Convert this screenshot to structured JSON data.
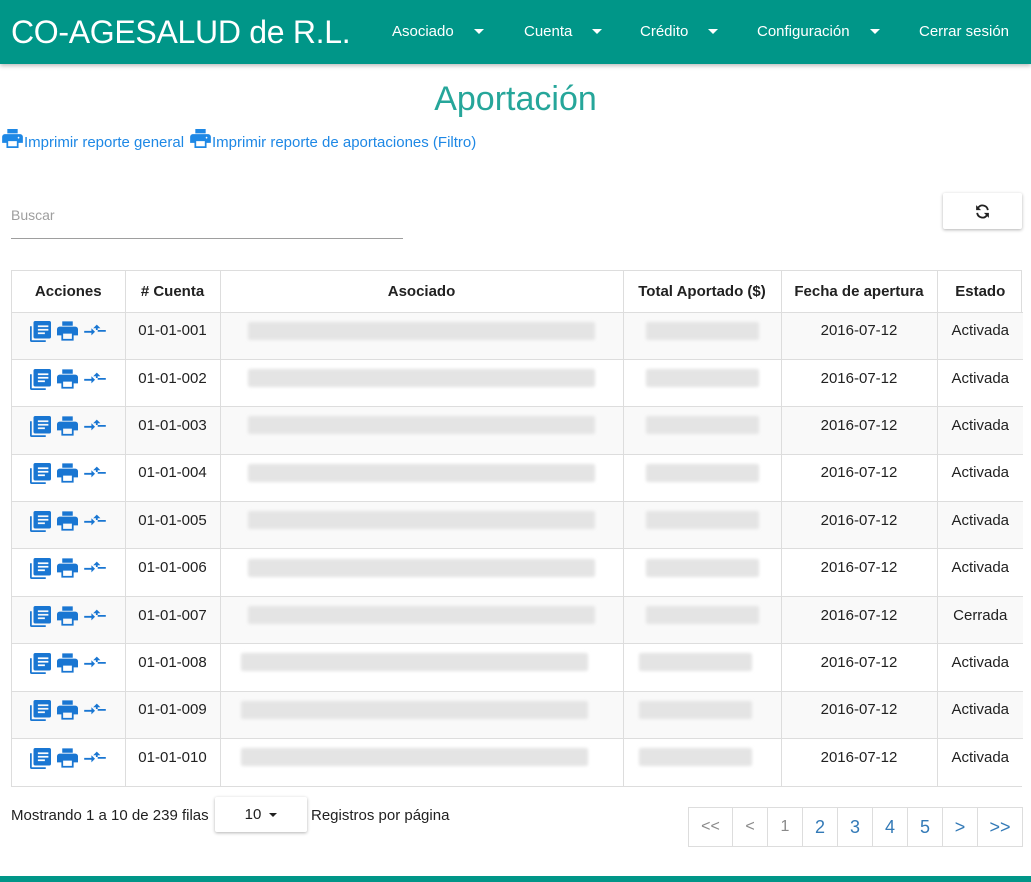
{
  "header": {
    "brand": "CO-AGESALUD de R.L.",
    "menu": [
      {
        "label": "Asociado",
        "has_caret": true
      },
      {
        "label": "Cuenta",
        "has_caret": true
      },
      {
        "label": "Crédito",
        "has_caret": true
      },
      {
        "label": "Configuración",
        "has_caret": true
      },
      {
        "label": "Cerrar sesión",
        "has_caret": false
      }
    ]
  },
  "page": {
    "title": "Aportación",
    "report_links": [
      {
        "label": "Imprimir reporte general",
        "icon": "printer-icon"
      },
      {
        "label": "Imprimir reporte de aportaciones (Filtro)",
        "icon": "printer-icon"
      }
    ]
  },
  "search": {
    "placeholder": "Buscar",
    "value": ""
  },
  "refresh_icon": "refresh-icon",
  "table": {
    "columns": [
      "Acciones",
      "# Cuenta",
      "Asociado",
      "Total Aportado ($)",
      "Fecha de apertura",
      "Estado"
    ],
    "action_icons": [
      "document-icon",
      "printer-icon",
      "transfer-icon"
    ],
    "rows": [
      {
        "cuenta": "01-01-001",
        "fecha": "2016-07-12",
        "estado": "Activada"
      },
      {
        "cuenta": "01-01-002",
        "fecha": "2016-07-12",
        "estado": "Activada"
      },
      {
        "cuenta": "01-01-003",
        "fecha": "2016-07-12",
        "estado": "Activada"
      },
      {
        "cuenta": "01-01-004",
        "fecha": "2016-07-12",
        "estado": "Activada"
      },
      {
        "cuenta": "01-01-005",
        "fecha": "2016-07-12",
        "estado": "Activada"
      },
      {
        "cuenta": "01-01-006",
        "fecha": "2016-07-12",
        "estado": "Activada"
      },
      {
        "cuenta": "01-01-007",
        "fecha": "2016-07-12",
        "estado": "Cerrada"
      },
      {
        "cuenta": "01-01-008",
        "fecha": "2016-07-12",
        "estado": "Activada"
      },
      {
        "cuenta": "01-01-009",
        "fecha": "2016-07-12",
        "estado": "Activada"
      },
      {
        "cuenta": "01-01-010",
        "fecha": "2016-07-12",
        "estado": "Activada"
      }
    ]
  },
  "pagination": {
    "info": "Mostrando 1 a 10 de 239 filas",
    "page_size": "10",
    "per_page_label": "Registros por página",
    "pages": [
      "<<",
      "<",
      "1",
      "2",
      "3",
      "4",
      "5",
      ">",
      ">>"
    ]
  },
  "colors": {
    "primary": "#009688",
    "title": "#26a69a",
    "link": "#1e88e5",
    "icon": "#1976d2"
  }
}
